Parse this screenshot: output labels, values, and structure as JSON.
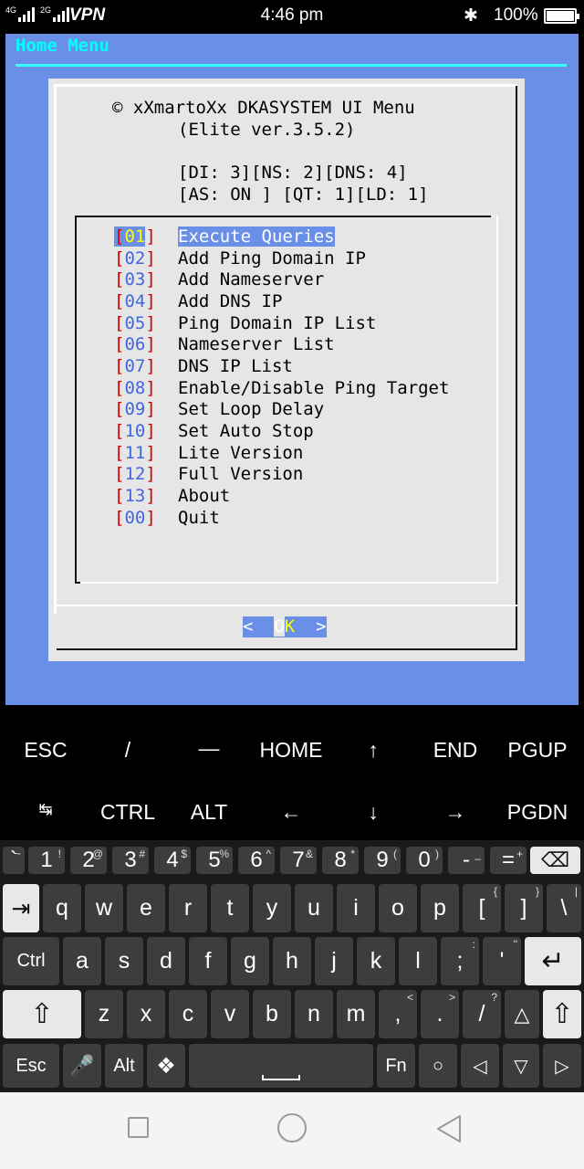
{
  "statusbar": {
    "signal1": "4G",
    "signal2": "2G",
    "vpn": "VPN",
    "time": "4:46 pm",
    "bluetooth_icon": "✱",
    "battery": "100%"
  },
  "terminal": {
    "title": "Home Menu",
    "header_line1": "© xXmartoXx DKASYSTEM UI Menu",
    "header_line2": "(Elite ver.3.5.2)",
    "status_line1": "[DI: 3][NS: 2][DNS: 4]",
    "status_line2": "[AS: ON ] [QT: 1][LD: 1]",
    "menu": [
      {
        "num": "01",
        "label": "Execute Queries"
      },
      {
        "num": "02",
        "label": "Add Ping Domain IP"
      },
      {
        "num": "03",
        "label": "Add Nameserver"
      },
      {
        "num": "04",
        "label": "Add DNS IP"
      },
      {
        "num": "05",
        "label": "Ping Domain IP List"
      },
      {
        "num": "06",
        "label": "Nameserver List"
      },
      {
        "num": "07",
        "label": "DNS IP List"
      },
      {
        "num": "08",
        "label": "Enable/Disable Ping Target"
      },
      {
        "num": "09",
        "label": "Set Loop Delay"
      },
      {
        "num": "10",
        "label": "Set Auto Stop"
      },
      {
        "num": "11",
        "label": "Lite Version"
      },
      {
        "num": "12",
        "label": "Full Version"
      },
      {
        "num": "13",
        "label": "About"
      },
      {
        "num": "00",
        "label": "Quit"
      }
    ],
    "ok_left": "<  ",
    "ok_o": "O",
    "ok_k": "K",
    "ok_right": "  >"
  },
  "extra_keys": {
    "row1": [
      "ESC",
      "/",
      "—",
      "HOME",
      "↑",
      "END",
      "PGUP"
    ],
    "row2": [
      "↹",
      "CTRL",
      "ALT",
      "←",
      "↓",
      "→",
      "PGDN"
    ]
  },
  "keyboard": {
    "row_num": [
      {
        "main": "`",
        "sup": "~"
      },
      {
        "main": "1",
        "sup": "!"
      },
      {
        "main": "2",
        "sup": "@"
      },
      {
        "main": "3",
        "sup": "#"
      },
      {
        "main": "4",
        "sup": "$"
      },
      {
        "main": "5",
        "sup": "%"
      },
      {
        "main": "6",
        "sup": "^"
      },
      {
        "main": "7",
        "sup": "&"
      },
      {
        "main": "8",
        "sup": "*"
      },
      {
        "main": "9",
        "sup": "("
      },
      {
        "main": "0",
        "sup": ")"
      },
      {
        "main": "-",
        "sup": "_"
      },
      {
        "main": "=",
        "sup": "+"
      }
    ],
    "row_q": [
      {
        "main": "q"
      },
      {
        "main": "w"
      },
      {
        "main": "e"
      },
      {
        "main": "r"
      },
      {
        "main": "t"
      },
      {
        "main": "y"
      },
      {
        "main": "u"
      },
      {
        "main": "i"
      },
      {
        "main": "o"
      },
      {
        "main": "p"
      },
      {
        "main": "[",
        "sup": "{"
      },
      {
        "main": "]",
        "sup": "}"
      },
      {
        "main": "\\",
        "sup": "|"
      }
    ],
    "row_a": [
      {
        "main": "a"
      },
      {
        "main": "s"
      },
      {
        "main": "d"
      },
      {
        "main": "f"
      },
      {
        "main": "g"
      },
      {
        "main": "h"
      },
      {
        "main": "j"
      },
      {
        "main": "k"
      },
      {
        "main": "l"
      },
      {
        "main": ";",
        "sup": ":"
      },
      {
        "main": "'",
        "sup": "\""
      }
    ],
    "row_z": [
      {
        "main": "z"
      },
      {
        "main": "x"
      },
      {
        "main": "c"
      },
      {
        "main": "v"
      },
      {
        "main": "b"
      },
      {
        "main": "n"
      },
      {
        "main": "m"
      },
      {
        "main": ",",
        "sup": "<"
      },
      {
        "main": ".",
        "sup": ">"
      },
      {
        "main": "/",
        "sup": "?"
      }
    ],
    "ctrl": "Ctrl",
    "esc": "Esc",
    "alt": "Alt",
    "fn": "Fn",
    "backspace_icon": "⌫",
    "tab_icon": "⇥",
    "enter_icon": "↵",
    "shift_icon": "⇧",
    "mic_icon": "🎤",
    "move_icon": "❖",
    "circle_icon": "○",
    "left_icon": "◁",
    "down_icon": "▽",
    "right_icon": "▷",
    "up_icon": "△"
  }
}
